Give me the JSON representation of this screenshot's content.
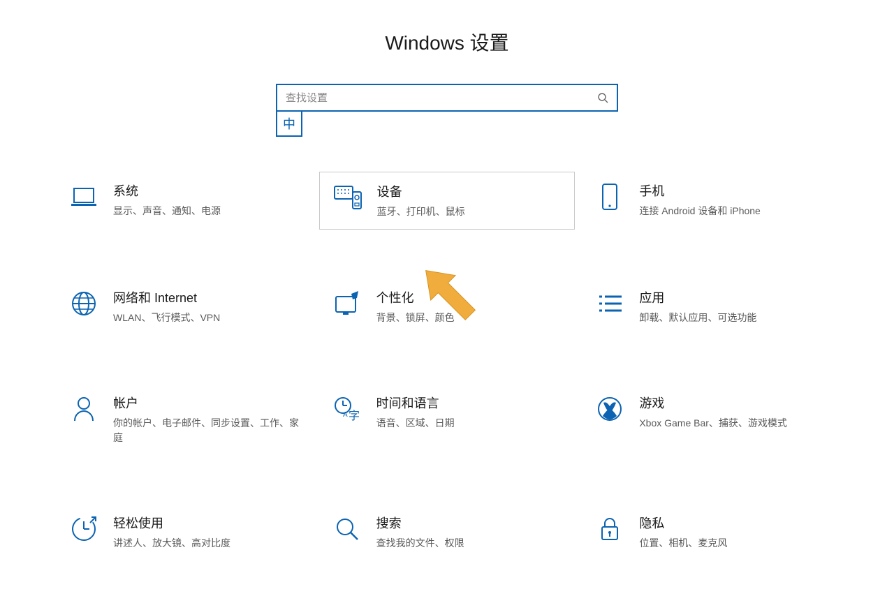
{
  "header": {
    "title": "Windows 设置"
  },
  "search": {
    "placeholder": "查找设置"
  },
  "ime": {
    "label": "中"
  },
  "tiles": [
    {
      "id": "system",
      "title": "系统",
      "desc": "显示、声音、通知、电源"
    },
    {
      "id": "devices",
      "title": "设备",
      "desc": "蓝牙、打印机、鼠标",
      "highlight": true
    },
    {
      "id": "phone",
      "title": "手机",
      "desc": "连接 Android 设备和 iPhone"
    },
    {
      "id": "network",
      "title": "网络和 Internet",
      "desc": "WLAN、飞行模式、VPN"
    },
    {
      "id": "personalize",
      "title": "个性化",
      "desc": "背景、锁屏、颜色"
    },
    {
      "id": "apps",
      "title": "应用",
      "desc": "卸载、默认应用、可选功能"
    },
    {
      "id": "accounts",
      "title": "帐户",
      "desc": "你的帐户、电子邮件、同步设置、工作、家庭"
    },
    {
      "id": "time",
      "title": "时间和语言",
      "desc": "语音、区域、日期"
    },
    {
      "id": "gaming",
      "title": "游戏",
      "desc": "Xbox Game Bar、捕获、游戏模式"
    },
    {
      "id": "ease",
      "title": "轻松使用",
      "desc": "讲述人、放大镜、高对比度"
    },
    {
      "id": "search",
      "title": "搜索",
      "desc": "查找我的文件、权限"
    },
    {
      "id": "privacy",
      "title": "隐私",
      "desc": "位置、相机、麦克风"
    }
  ],
  "colors": {
    "accent": "#0b63b1",
    "arrow": "#f0ad3e"
  }
}
